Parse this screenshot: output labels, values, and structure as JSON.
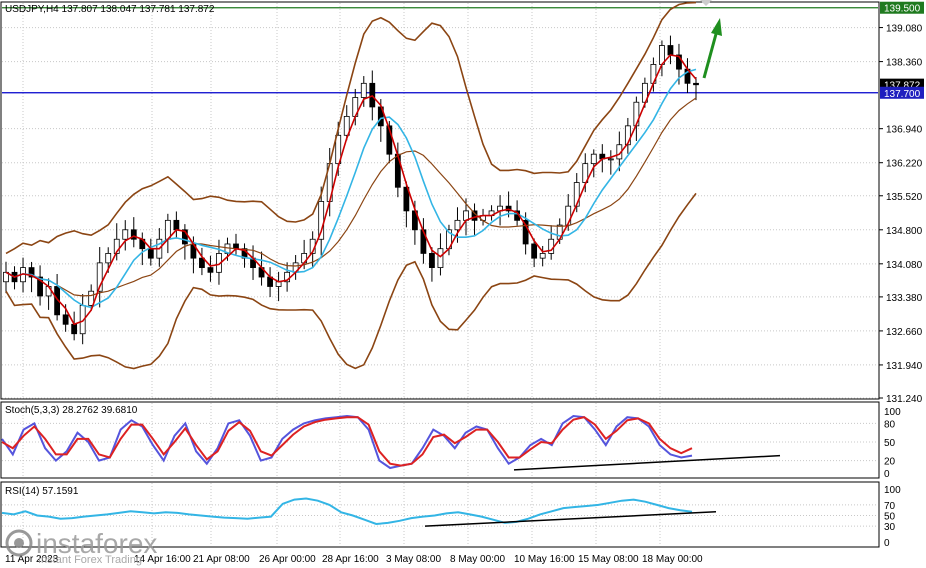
{
  "chart_data": [
    {
      "type": "candlestick",
      "panel": "main",
      "header": "USDJPY,H4  137.807 138.047 137.781 137.872",
      "symbol": "USDJPY",
      "timeframe": "H4",
      "ohlc": {
        "open": 137.807,
        "high": 138.047,
        "low": 137.781,
        "close": 137.872
      },
      "ylim": [
        131.24,
        139.6
      ],
      "y_ticks": [
        "139.080",
        "138.360",
        "136.940",
        "136.220",
        "135.520",
        "134.800",
        "134.080",
        "133.380",
        "132.660",
        "131.940",
        "131.240"
      ],
      "x_ticks": [
        "11 Apr 2023",
        "14 Apr 16:00",
        "21 Apr 08:00",
        "26 Apr 00:00",
        "28 Apr 16:00",
        "3 May 08:00",
        "8 May 00:00",
        "10 May 16:00",
        "15 May 08:00",
        "18 May 00:00"
      ],
      "price_labels": [
        {
          "text": "139.500",
          "value": 139.5,
          "bg": "#1f7a1f"
        },
        {
          "text": "137.872",
          "value": 137.872,
          "bg": "#000000"
        },
        {
          "text": "137.700",
          "value": 137.7,
          "bg": "#1f1fbf"
        }
      ],
      "horizontal_lines": [
        {
          "value": 139.5,
          "color": "#1f7a1f"
        },
        {
          "value": 137.7,
          "color": "#0000cc"
        }
      ],
      "candle_closes": [
        133.9,
        133.7,
        134.0,
        133.8,
        133.4,
        133.6,
        133.0,
        132.8,
        132.6,
        133.2,
        133.5,
        134.1,
        134.3,
        134.6,
        134.8,
        134.6,
        134.4,
        134.2,
        134.6,
        135.0,
        134.8,
        134.5,
        134.2,
        134.0,
        133.9,
        134.3,
        134.5,
        134.4,
        134.2,
        134.0,
        133.8,
        133.6,
        133.7,
        133.9,
        134.1,
        134.3,
        134.6,
        135.4,
        136.2,
        136.8,
        137.2,
        137.6,
        137.9,
        137.4,
        137.0,
        136.4,
        135.7,
        135.2,
        134.8,
        134.3,
        134.0,
        134.4,
        134.8,
        135.0,
        135.2,
        135.0,
        135.1,
        135.2,
        135.3,
        135.2,
        135.0,
        134.5,
        134.2,
        134.3,
        134.6,
        134.9,
        135.3,
        135.8,
        136.2,
        136.4,
        136.3,
        136.3,
        136.6,
        137.0,
        137.5,
        137.9,
        138.3,
        138.7,
        138.5,
        138.2,
        137.9,
        137.87
      ],
      "indicators": [
        "Bollinger Bands",
        "Moving Average (fast, red)",
        "Moving Average (slow, blue)"
      ],
      "annotations": [
        "green arrow pointing up toward 139.500"
      ],
      "grid": true,
      "colors": {
        "bull_candle": "#000000",
        "bear_candle": "#000000",
        "ma_fast": "#cc0000",
        "ma_slow": "#33b5e5",
        "bands": "#8b4513",
        "arrow": "#1f8f1f"
      }
    },
    {
      "type": "line",
      "panel": "stochastic",
      "header": "Stoch(5,3,3) 28.2762 39.6810",
      "ylim": [
        0,
        100
      ],
      "y_ticks": [
        "100",
        "80",
        "50",
        "20",
        "0"
      ],
      "series": [
        {
          "name": "%K",
          "color": "#5555dd",
          "values": [
            55,
            30,
            70,
            80,
            40,
            20,
            35,
            65,
            50,
            20,
            25,
            70,
            85,
            75,
            45,
            20,
            60,
            80,
            35,
            15,
            40,
            80,
            85,
            60,
            20,
            25,
            55,
            70,
            80,
            85,
            88,
            90,
            92,
            90,
            70,
            20,
            8,
            12,
            15,
            40,
            70,
            60,
            40,
            65,
            75,
            70,
            40,
            15,
            25,
            45,
            55,
            45,
            80,
            92,
            90,
            70,
            45,
            75,
            90,
            88,
            75,
            45,
            30,
            25,
            28
          ]
        },
        {
          "name": "%D",
          "color": "#dd2222",
          "values": [
            50,
            40,
            60,
            75,
            55,
            30,
            30,
            55,
            55,
            30,
            25,
            55,
            78,
            78,
            55,
            30,
            50,
            72,
            45,
            22,
            35,
            68,
            82,
            68,
            35,
            28,
            45,
            62,
            75,
            82,
            86,
            88,
            90,
            90,
            78,
            35,
            15,
            12,
            15,
            30,
            58,
            62,
            48,
            58,
            70,
            70,
            50,
            25,
            25,
            38,
            50,
            48,
            70,
            86,
            90,
            78,
            55,
            68,
            85,
            88,
            80,
            55,
            40,
            32,
            40
          ]
        }
      ],
      "levels": [
        20,
        50,
        80
      ],
      "trendline": "rising support line along stochastic lows"
    },
    {
      "type": "line",
      "panel": "rsi",
      "header": "RSI(14) 57.1591",
      "ylim": [
        0,
        100
      ],
      "y_ticks": [
        "100",
        "70",
        "50",
        "30",
        "0"
      ],
      "series": [
        {
          "name": "RSI(14)",
          "color": "#33b5e5",
          "values": [
            55,
            52,
            58,
            50,
            48,
            44,
            45,
            48,
            50,
            52,
            55,
            58,
            56,
            54,
            56,
            55,
            52,
            50,
            48,
            46,
            45,
            44,
            46,
            48,
            72,
            80,
            82,
            78,
            70,
            56,
            50,
            42,
            34,
            36,
            40,
            45,
            48,
            50,
            54,
            56,
            52,
            48,
            42,
            36,
            38,
            44,
            52,
            58,
            64,
            66,
            68,
            70,
            74,
            78,
            80,
            76,
            70,
            64,
            60,
            57
          ]
        }
      ],
      "levels": [
        30,
        50,
        70
      ],
      "trendline": "rising support line along RSI lows"
    }
  ],
  "watermark": {
    "brand": "instaforex",
    "tagline": "Instant Forex Trading"
  }
}
